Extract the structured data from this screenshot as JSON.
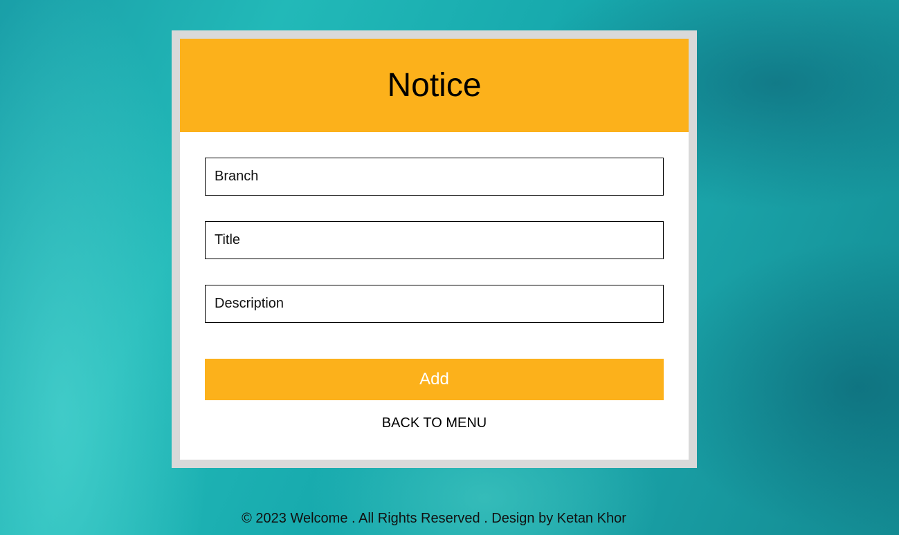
{
  "card": {
    "title": "Notice",
    "fields": [
      {
        "placeholder": "Branch"
      },
      {
        "placeholder": "Title"
      },
      {
        "placeholder": "Description"
      }
    ],
    "add_label": "Add",
    "back_label": "BACK TO MENU"
  },
  "footer": {
    "text": "© 2023 Welcome . All Rights Reserved . Design by Ketan Khor"
  },
  "colors": {
    "accent": "#fcb11b",
    "frame": "#d9d9d9",
    "background": "#1aa9ad"
  }
}
